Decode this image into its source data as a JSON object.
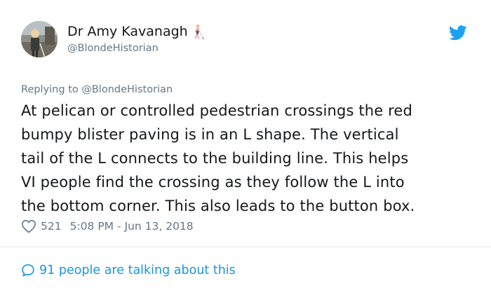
{
  "tweet": {
    "author": {
      "display_name": "Dr Amy Kavanagh",
      "name_emoji_icon": "person-with-probing-cane-icon",
      "handle": "@BlondeHistorian"
    },
    "platform_icon": "twitter-bird-icon",
    "replying_to": {
      "prefix": "Replying to",
      "mention": "@BlondeHistorian"
    },
    "text_lines": [
      "At pelican or controlled pedestrian crossings the red",
      "bumpy blister paving is in an L shape. The vertical",
      "tail of the L connects to the building line. This helps",
      "VI people find the crossing as they follow the L into",
      "the bottom corner. This also leads to the button box."
    ],
    "likes": "521",
    "timestamp": "5:08 PM - Jun 13, 2018",
    "talking_about": "91 people are talking about this",
    "accent_color": "#1b95e0",
    "muted_color": "#657786"
  }
}
